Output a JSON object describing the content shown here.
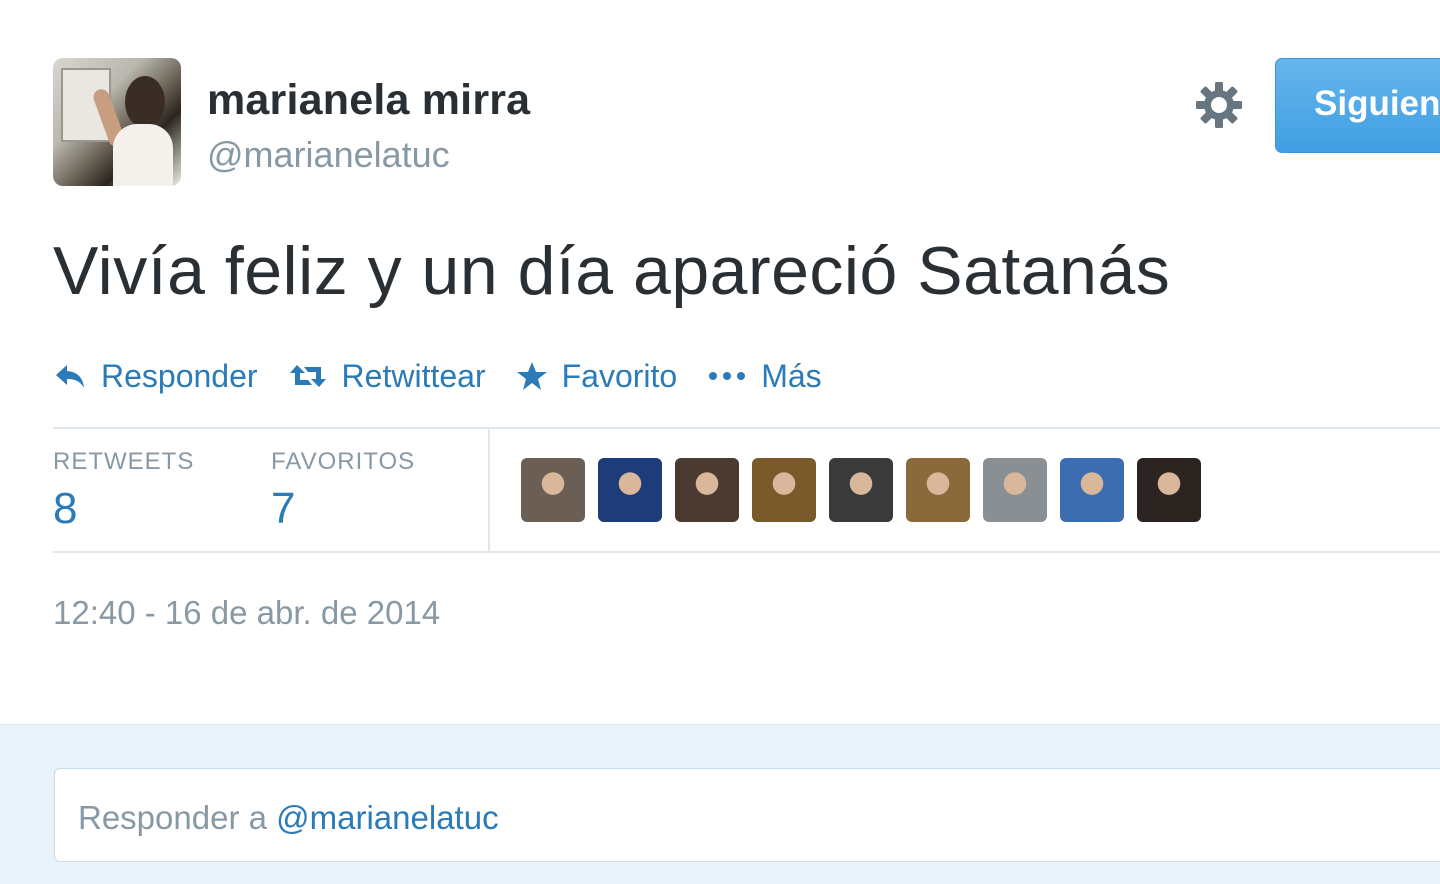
{
  "user": {
    "name": "marianela mirra",
    "handle": "@marianelatuc",
    "avatar_icon": "avatar-photo"
  },
  "header_actions": {
    "settings_icon": "gear-icon",
    "follow_label": "Siguien"
  },
  "tweet": {
    "text": "Vivía feliz y un día apareció Satanás"
  },
  "actions": [
    {
      "icon": "reply-icon",
      "label": "Responder"
    },
    {
      "icon": "retweet-icon",
      "label": "Retwittear"
    },
    {
      "icon": "star-icon",
      "label": "Favorito"
    },
    {
      "icon": "more-icon",
      "label": "Más"
    }
  ],
  "stats": {
    "retweets_label": "RETWEETS",
    "retweets_count": "8",
    "favorites_label": "FAVORITOS",
    "favorites_count": "7"
  },
  "favoriters": [
    {
      "color": "#6b5f55"
    },
    {
      "color": "#1e3c7a"
    },
    {
      "color": "#4a3a30"
    },
    {
      "color": "#7a5a2a"
    },
    {
      "color": "#3a3a3a"
    },
    {
      "color": "#8a6a3a"
    },
    {
      "color": "#8a8f94"
    },
    {
      "color": "#3b6db0"
    },
    {
      "color": "#2c2420"
    }
  ],
  "timestamp": "12:40 - 16 de abr. de 2014",
  "reply": {
    "prefix": "Responder a",
    "mention": "@marianelatuc"
  },
  "colors": {
    "link_blue": "#2b7bb9",
    "muted_gray": "#8899a6",
    "follow_button": "#55acee",
    "reply_background": "#e8f3f9"
  }
}
